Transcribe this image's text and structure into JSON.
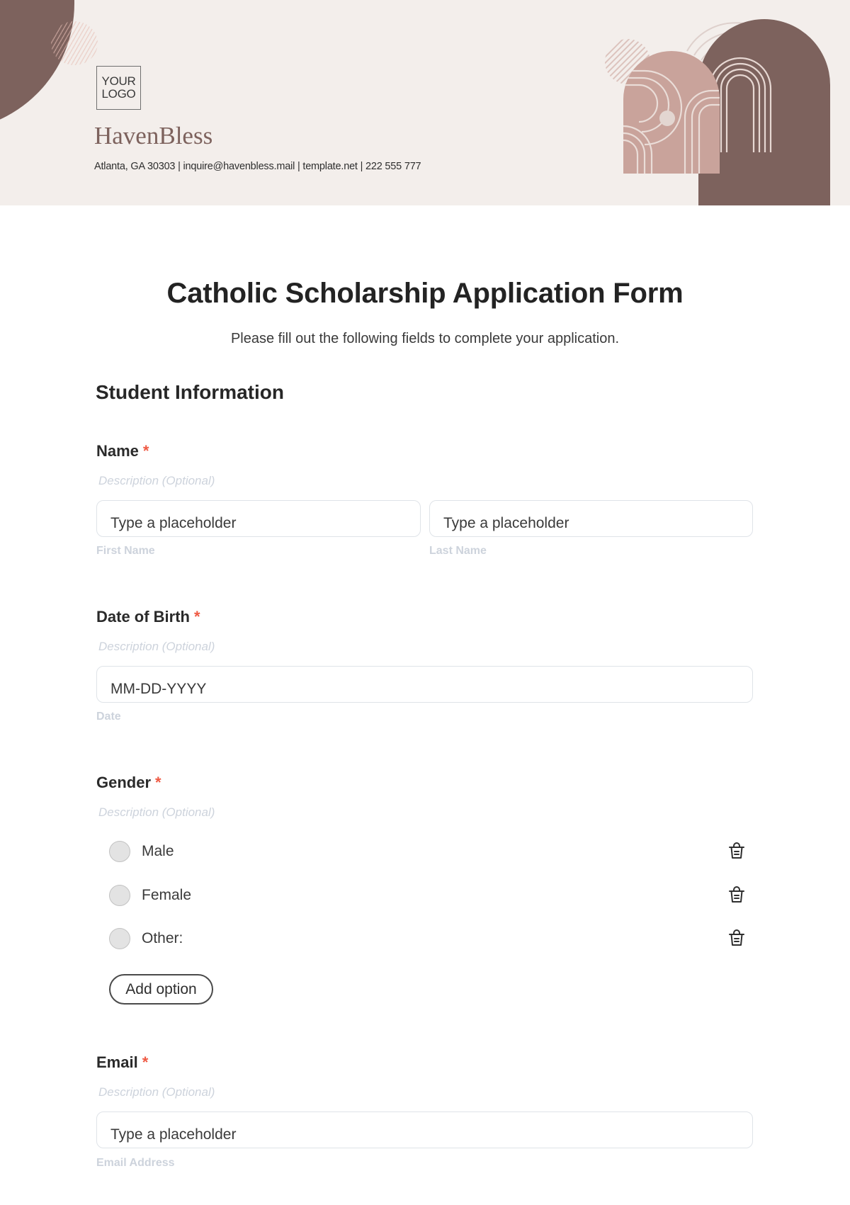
{
  "header": {
    "logo_text": "YOUR\nLOGO",
    "brand_name": "HavenBless",
    "contact_line": "Atlanta, GA 30303 | inquire@havenbless.mail | template.net | 222 555 777",
    "colors": {
      "background": "#f3eeeb",
      "brand_dark": "#7d625d",
      "brand_light": "#c9a39b"
    }
  },
  "form": {
    "title": "Catholic Scholarship Application Form",
    "subtitle": "Please fill out the following fields to complete your application.",
    "section_title": "Student Information",
    "required_marker": "*",
    "fields": {
      "name": {
        "label": "Name",
        "description": "Description (Optional)",
        "first": {
          "placeholder": "Type a placeholder",
          "sublabel": "First Name"
        },
        "last": {
          "placeholder": "Type a placeholder",
          "sublabel": "Last Name"
        }
      },
      "dob": {
        "label": "Date of Birth",
        "description": "Description (Optional)",
        "placeholder": "MM-DD-YYYY",
        "sublabel": "Date"
      },
      "gender": {
        "label": "Gender",
        "description": "Description (Optional)",
        "options": [
          {
            "label": "Male",
            "icon": "trash-icon"
          },
          {
            "label": "Female",
            "icon": "trash-icon"
          },
          {
            "label": "Other:",
            "icon": "trash-icon"
          }
        ],
        "add_option_label": "Add option"
      },
      "email": {
        "label": "Email",
        "description": "Description (Optional)",
        "placeholder": "Type a placeholder",
        "sublabel": "Email Address"
      }
    },
    "colors": {
      "required": "#ef5a44",
      "muted": "#cdd3dc",
      "input_border": "#dfe3e8"
    }
  }
}
